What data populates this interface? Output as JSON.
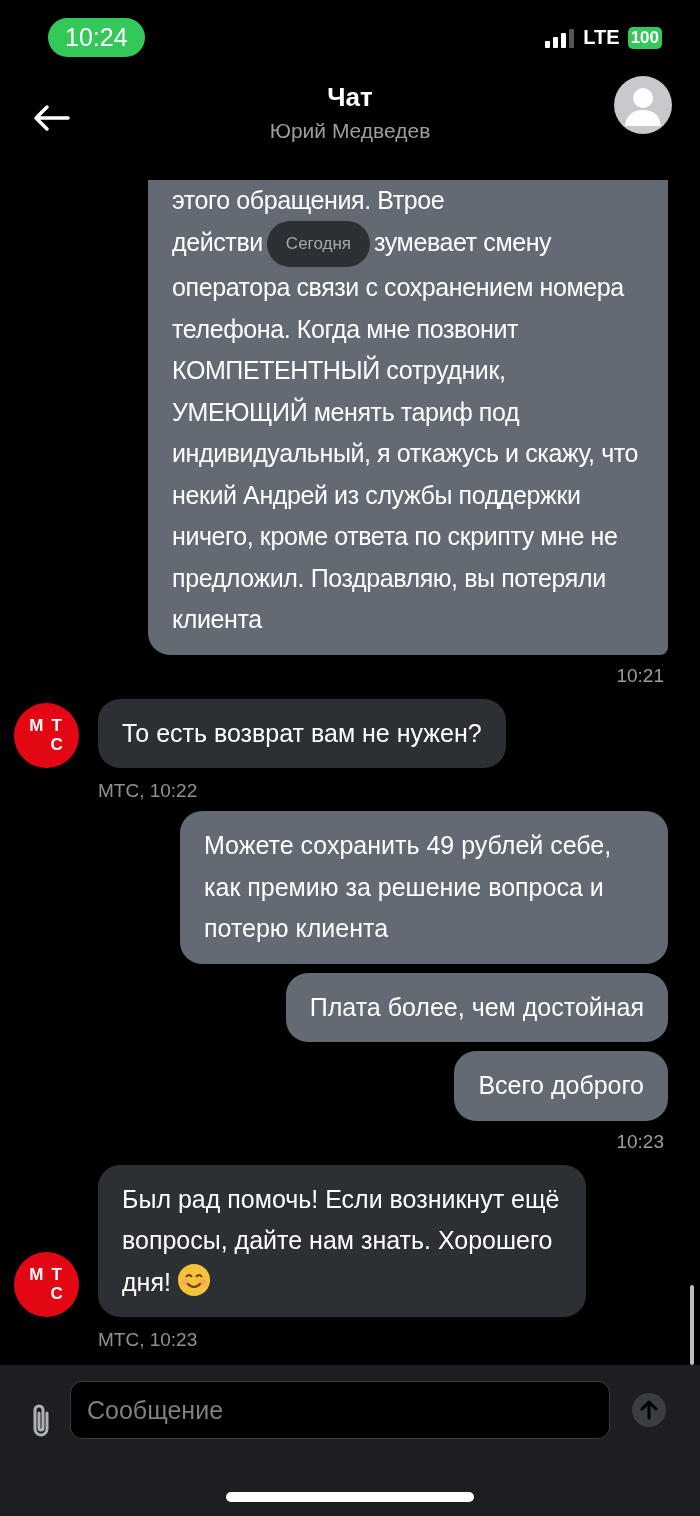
{
  "status_bar": {
    "time": "10:24",
    "network": "LTE",
    "battery": "100"
  },
  "header": {
    "title": "Чат",
    "subtitle": "Юрий Медведев"
  },
  "date_chip": "Сегодня",
  "messages": [
    {
      "kind": "outgoing",
      "partial": true,
      "first_line": "этого обращения. Втрое",
      "second_line_start": "действи",
      "second_line_end": "зумевает смену",
      "text": "оператора связи с сохранением номера телефона. Когда мне позвонит КОМПЕТЕНТНЫЙ сотрудник, УМЕЮЩИЙ менять тариф под индивидуальный, я откажусь и скажу, что некий Андрей из службы поддержки ничего, кроме ответа по скрипту мне не предложил. Поздравляю, вы потеряли клиента"
    },
    {
      "kind": "time",
      "text": "10:21"
    },
    {
      "kind": "incoming",
      "text": "То есть возврат вам не нужен?",
      "emoji": false,
      "meta": "МТС, 10:22",
      "logo": [
        "М",
        "Т",
        "С"
      ]
    },
    {
      "kind": "outgoing",
      "text": "Можете сохранить 49 рублей себе, как премию за решение вопроса и потерю клиента"
    },
    {
      "kind": "outgoing",
      "text": "Плата более, чем достойная"
    },
    {
      "kind": "outgoing",
      "text": "Всего доброго"
    },
    {
      "kind": "time",
      "text": "10:23"
    },
    {
      "kind": "incoming",
      "text": "Был рад помочь! Если возникнут ещё вопросы, дайте нам знать. Хорошего дня!",
      "emoji": true,
      "meta": "МТС, 10:23",
      "logo": [
        "М",
        "Т",
        "С"
      ]
    }
  ],
  "composer": {
    "placeholder": "Сообщение"
  }
}
